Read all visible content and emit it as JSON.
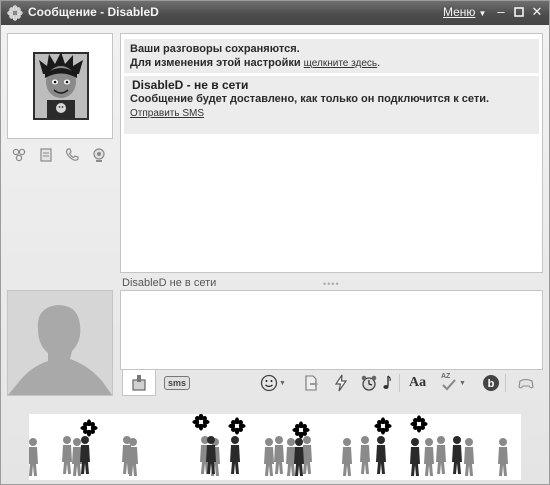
{
  "window": {
    "title": "Сообщение - DisableD",
    "menu_label": "Меню"
  },
  "history": {
    "notice1_line1": "Ваши разговоры сохраняются.",
    "notice1_line2": "Для изменения этой настройки",
    "notice1_link": "щелкните здесь",
    "notice1_tail": ".",
    "notice2_header": "DisableD - не в сети",
    "notice2_body": "Сообщение будет доставлено, как только он подключится к сети.",
    "notice2_link": "Отправить SMS"
  },
  "status": {
    "text": "DisableD не в сети"
  },
  "input": {
    "value": "",
    "placeholder": ""
  },
  "toolbar": {
    "sms_label": "sms",
    "format_label": "Aa",
    "spell_label": "AZ"
  },
  "icons": {
    "title": "icq-flower-icon",
    "contact_actions": [
      "group-icon",
      "notes-icon",
      "phone-icon",
      "webcam-icon"
    ],
    "tools": [
      "smiley-icon",
      "send-file-icon",
      "zap-icon",
      "wakeup-icon",
      "font-format-icon",
      "spellcheck-icon",
      "buzz-icon",
      "games-icon"
    ]
  }
}
